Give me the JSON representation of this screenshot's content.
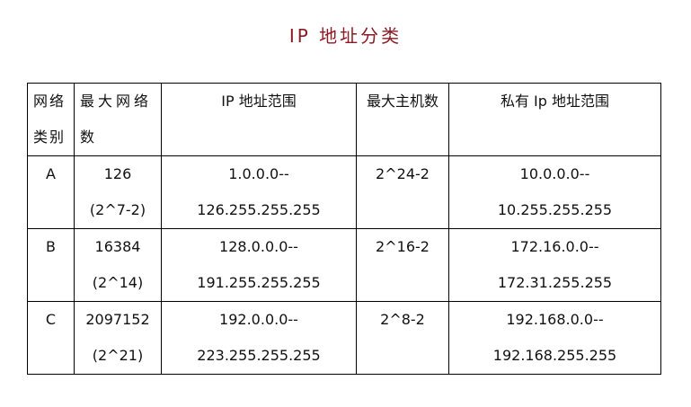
{
  "title": "IP 地址分类",
  "table": {
    "headers": [
      [
        "网络",
        "类别"
      ],
      [
        "最大网络",
        "数"
      ],
      [
        "IP 地址范围"
      ],
      [
        "最大主机数"
      ],
      [
        "私有 Ip 地址范围"
      ]
    ],
    "rows": [
      {
        "class": "A",
        "networks": [
          "126",
          "(2^7-2)"
        ],
        "ip_range": [
          "1.0.0.0--",
          "126.255.255.255"
        ],
        "max_hosts": "2^24-2",
        "private_range": [
          "10.0.0.0--",
          "10.255.255.255"
        ]
      },
      {
        "class": "B",
        "networks": [
          "16384",
          "(2^14)"
        ],
        "ip_range": [
          "128.0.0.0--",
          "191.255.255.255"
        ],
        "max_hosts": "2^16-2",
        "private_range": [
          "172.16.0.0--",
          "172.31.255.255"
        ]
      },
      {
        "class": "C",
        "networks": [
          "2097152",
          "(2^21)"
        ],
        "ip_range": [
          "192.0.0.0--",
          "223.255.255.255"
        ],
        "max_hosts": "2^8-2",
        "private_range": [
          "192.168.0.0--",
          "192.168.255.255"
        ]
      }
    ]
  }
}
